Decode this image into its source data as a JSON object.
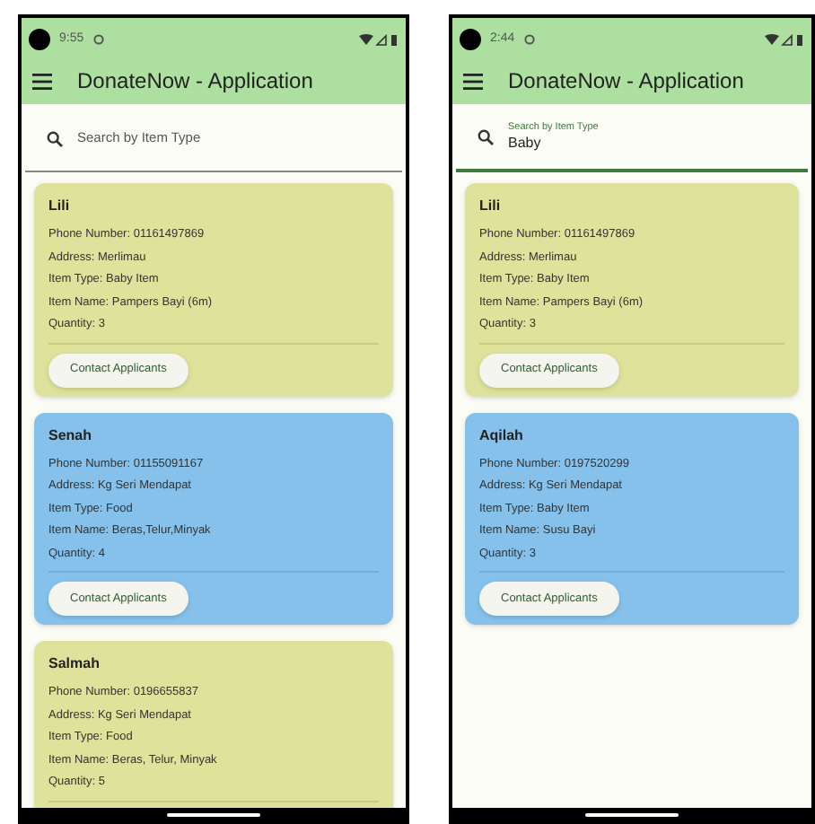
{
  "screens": [
    {
      "status_bar": {
        "time": "9:55"
      },
      "app_bar": {
        "title": "DonateNow - Application"
      },
      "search": {
        "placeholder": "Search by Item Type"
      },
      "cards": [
        {
          "name": "Lili",
          "color": "#dfe29b",
          "lines": [
            "Phone Number: 01161497869",
            "Address: Merlimau",
            "Item Type: Baby Item",
            "Item Name: Pampers Bayi (6m)",
            "Quantity: 3"
          ],
          "button": "Contact Applicants"
        },
        {
          "name": "Senah",
          "color": "#85c1ea",
          "lines": [
            "Phone Number: 01155091167",
            "Address: Kg Seri Mendapat",
            "Item Type: Food",
            "Item Name: Beras,Telur,Minyak",
            "Quantity: 4"
          ],
          "button": "Contact Applicants"
        },
        {
          "name": "Salmah",
          "color": "#dfe29b",
          "lines": [
            "Phone Number: 0196655837",
            "Address: Kg Seri Mendapat",
            "Item Type: Food",
            "Item Name: Beras, Telur, Minyak",
            "Quantity: 5"
          ]
        }
      ]
    },
    {
      "status_bar": {
        "time": "2:44"
      },
      "app_bar": {
        "title": "DonateNow - Application"
      },
      "search": {
        "label": "Search by Item Type",
        "value": "Baby"
      },
      "cards": [
        {
          "name": "Lili",
          "color": "#dfe29b",
          "lines": [
            "Phone Number: 01161497869",
            "Address: Merlimau",
            "Item Type: Baby Item",
            "Item Name: Pampers Bayi (6m)",
            "Quantity: 3"
          ],
          "button": "Contact Applicants"
        },
        {
          "name": "Aqilah",
          "color": "#85c1ea",
          "lines": [
            "Phone Number: 0197520299",
            "Address: Kg Seri Mendapat",
            "Item Type: Baby Item",
            "Item Name: Susu Bayi",
            "Quantity: 3"
          ],
          "button": "Contact Applicants"
        }
      ]
    }
  ]
}
